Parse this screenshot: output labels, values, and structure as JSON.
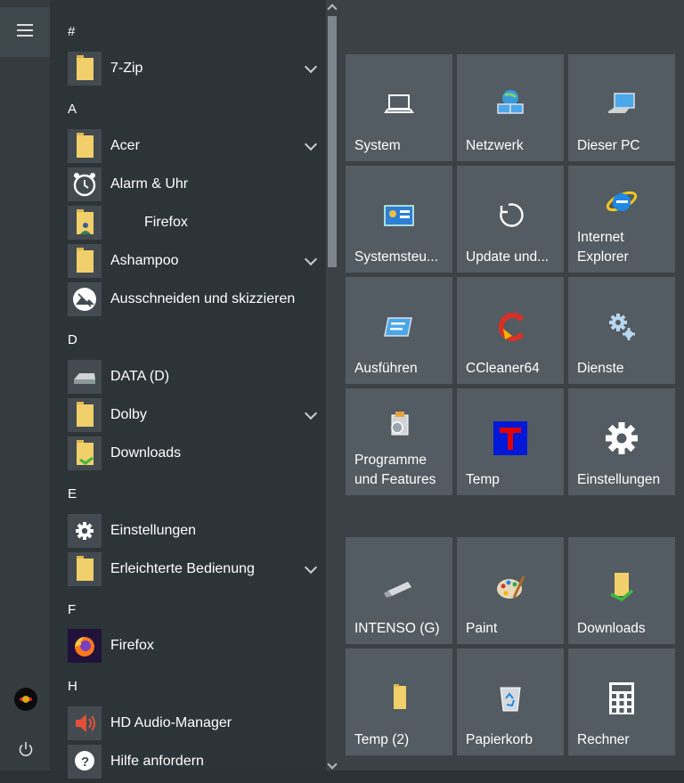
{
  "app_list": {
    "groups": [
      {
        "header": "#",
        "apps": [
          {
            "label": "7-Zip"
          }
        ]
      },
      {
        "header": "A",
        "apps": [
          {
            "label": "Acer"
          },
          {
            "label": "Alarm & Uhr"
          },
          {
            "label": "Firefox"
          },
          {
            "label": "Ashampoo"
          },
          {
            "label": "Ausschneiden und skizzieren"
          }
        ]
      },
      {
        "header": "D",
        "apps": [
          {
            "label": "DATA (D)"
          },
          {
            "label": "Dolby"
          },
          {
            "label": "Downloads"
          }
        ]
      },
      {
        "header": "E",
        "apps": [
          {
            "label": "Einstellungen"
          },
          {
            "label": "Erleichterte Bedienung"
          }
        ]
      },
      {
        "header": "F",
        "apps": [
          {
            "label": "Firefox"
          }
        ]
      },
      {
        "header": "H",
        "apps": [
          {
            "label": "HD Audio-Manager"
          },
          {
            "label": "Hilfe anfordern"
          }
        ]
      }
    ]
  },
  "tiles": {
    "group1": [
      {
        "label": "System",
        "icon": "laptop-icon"
      },
      {
        "label": "Netzwerk",
        "icon": "network-icon"
      },
      {
        "label": "Dieser PC",
        "icon": "computer-icon"
      },
      {
        "label": "Systemsteu...",
        "icon": "control-panel-icon"
      },
      {
        "label": "Update und...",
        "icon": "update-icon"
      },
      {
        "label": "Internet Explorer",
        "icon": "internet-explorer-icon"
      },
      {
        "label": "Ausführen",
        "icon": "run-icon"
      },
      {
        "label": "CCleaner64",
        "icon": "ccleaner-icon"
      },
      {
        "label": "Dienste",
        "icon": "services-gears-icon"
      },
      {
        "label": "Programme und Features",
        "icon": "programs-icon"
      },
      {
        "label": "Temp",
        "icon": "temp-t-icon"
      },
      {
        "label": "Einstellungen",
        "icon": "settings-gear-icon"
      }
    ],
    "group2": [
      {
        "label": "INTENSO (G)",
        "icon": "usb-drive-icon"
      },
      {
        "label": "Paint",
        "icon": "paint-palette-icon"
      },
      {
        "label": "Downloads",
        "icon": "downloads-folder-icon"
      },
      {
        "label": "Temp (2)",
        "icon": "folder-icon"
      },
      {
        "label": "Papierkorb",
        "icon": "recycle-bin-icon"
      },
      {
        "label": "Rechner",
        "icon": "calculator-icon"
      }
    ]
  },
  "colors": {
    "tile": "#535c62",
    "background": "#2d3438",
    "accent_ie": "#1e88e5"
  }
}
